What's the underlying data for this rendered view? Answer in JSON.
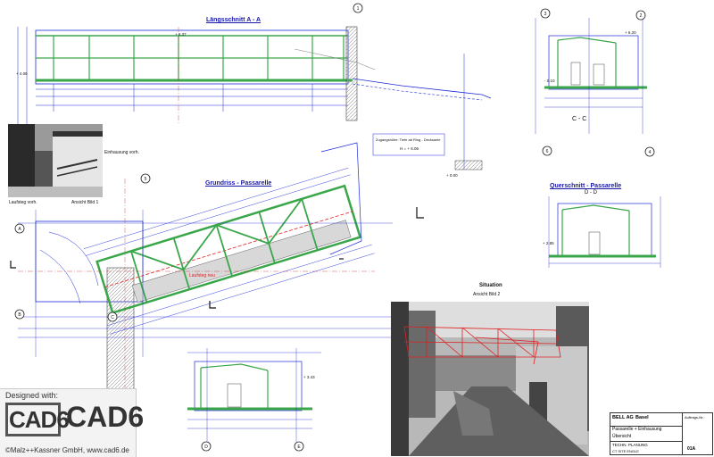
{
  "drawing": {
    "titles": {
      "longitudinal_section": "Längsschnitt A - A",
      "plan": "Grundriss - Passarelle",
      "cross_section": "Querschnitt - Passarelle",
      "section_cc": "C - C",
      "section_dd": "D - D",
      "situation": "Situation",
      "view_top_photo": "Ansicht Bild 1",
      "view_bottom_photo": "Ansicht Bild 2",
      "photo1_left_caption": "Laufsteg vorh.",
      "photo1_right_caption": "Einhausung vorh.",
      "loading_ramp": "Laufsteg neu"
    },
    "axis_markers": [
      "1",
      "2",
      "3",
      "4",
      "5",
      "6",
      "A",
      "B",
      "C",
      "D",
      "E"
    ],
    "elevations": [
      "+ 6.37",
      "+ 4.06",
      "+ 0.00",
      "- 0.10",
      "+ 2.85",
      "+ 6.20",
      "+ 3.43"
    ],
    "note_box": [
      "Zugangshöhe: Tiefe ab Ring - Decksaele",
      "H = + 6.06"
    ]
  },
  "title_block": {
    "client": "BELL AG",
    "city": "Basel",
    "project": "Passarelle + Einhausung",
    "sheet": "Übersicht",
    "department": "TECHN. PLANUNG",
    "company": "CT SITE ENGLE",
    "drawing_no": "01A",
    "order_label": "Auftrags-Nr.:"
  },
  "badge": {
    "designed_with": "Designed with:",
    "logo_box": "CAD6",
    "logo_text": "CAD6",
    "copyright": "©Malz++Kassner GmbH, www.cad6.de"
  },
  "colors": {
    "steel": "#1e2bd8",
    "beam": "#3aa64a",
    "dimension": "#2a2a9a",
    "red_outline": "#e02020"
  }
}
